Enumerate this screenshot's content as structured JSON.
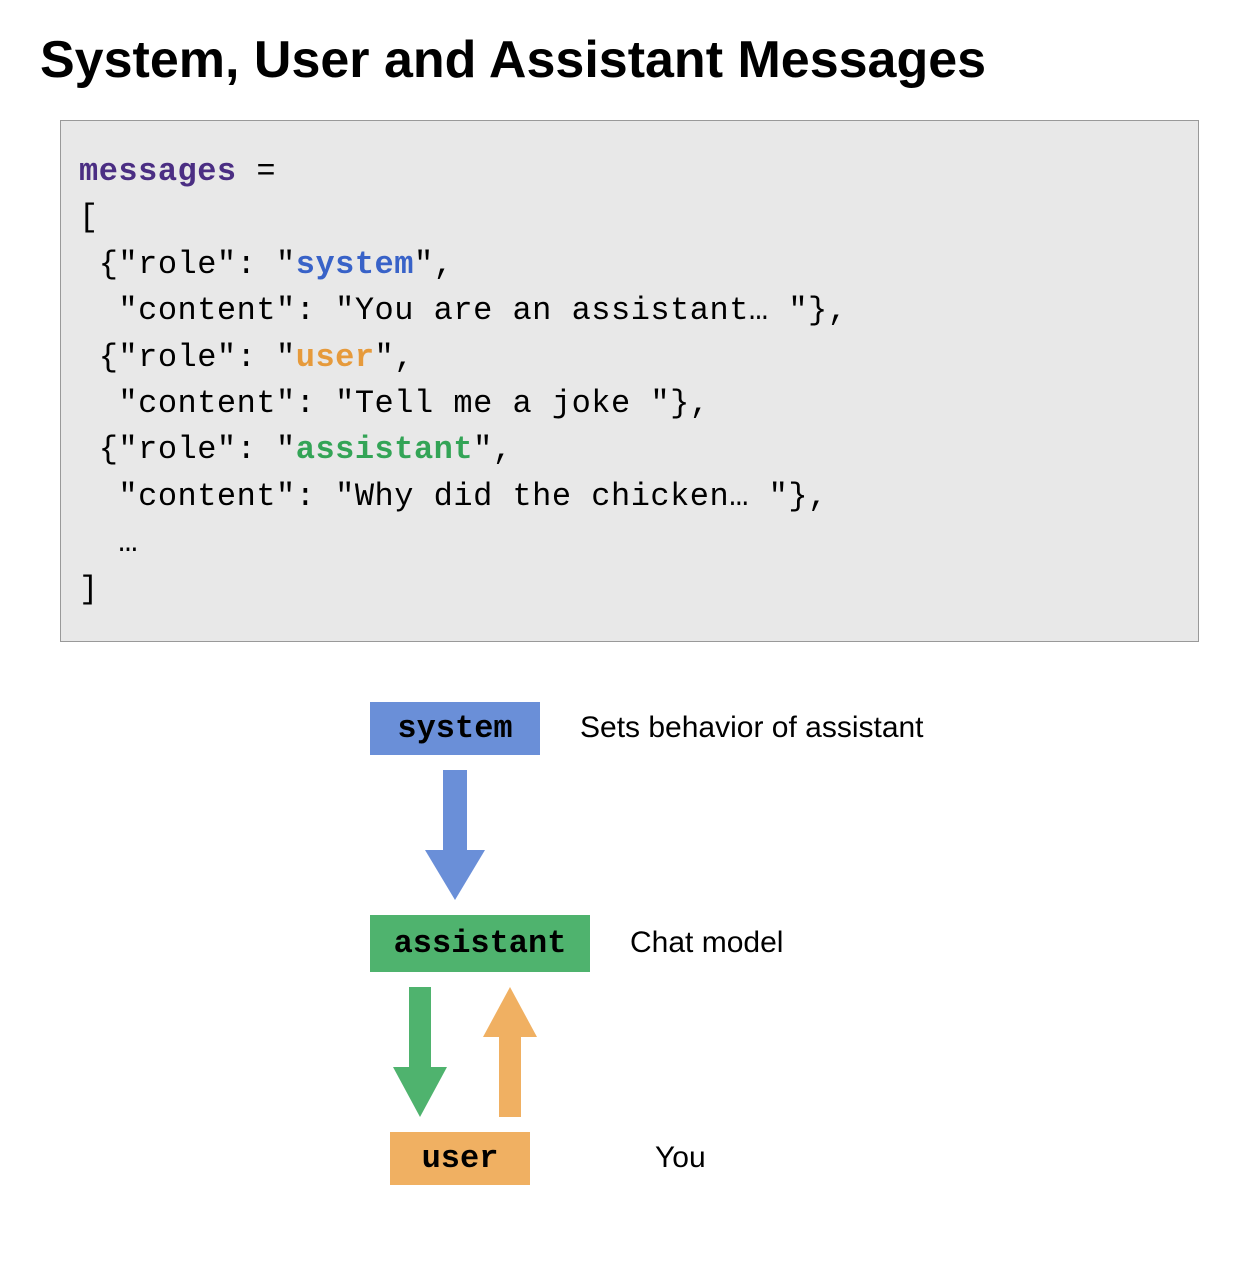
{
  "title": "System, User and Assistant Messages",
  "code": {
    "varname": "messages",
    "equals": " =",
    "open_bracket": "[",
    "entries": [
      {
        "role": "system",
        "content": "You are an assistant… "
      },
      {
        "role": "user",
        "content": "Tell me a joke "
      },
      {
        "role": "assistant",
        "content": "Why did the chicken… "
      }
    ],
    "ellipsis": "…",
    "close_bracket": "]"
  },
  "diagram": {
    "nodes": {
      "system": {
        "label": "system",
        "desc": "Sets behavior of assistant"
      },
      "assistant": {
        "label": "assistant",
        "desc": "Chat model"
      },
      "user": {
        "label": "user",
        "desc": "You"
      }
    }
  },
  "colors": {
    "system": "#6a8fd8",
    "assistant": "#4fb36e",
    "user": "#f0b062"
  }
}
